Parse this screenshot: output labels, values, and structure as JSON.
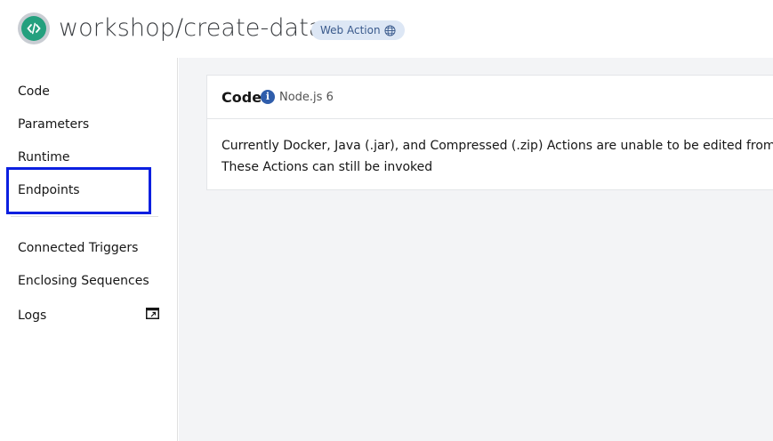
{
  "header": {
    "title": "workshop/create-data",
    "badge": "Web Action"
  },
  "sidebar": {
    "items": [
      {
        "label": "Code"
      },
      {
        "label": "Parameters"
      },
      {
        "label": "Runtime"
      },
      {
        "label": "Endpoints"
      },
      {
        "label": "Connected Triggers"
      },
      {
        "label": "Enclosing Sequences"
      },
      {
        "label": "Logs"
      }
    ]
  },
  "code_panel": {
    "title": "Code",
    "runtime": "Node.js 6",
    "message_line1": "Currently Docker, Java (.jar), and Compressed (.zip) Actions are unable to be edited from",
    "message_line2": "These Actions can still be invoked"
  },
  "colors": {
    "highlight": "#0b1fe0",
    "accent": "#24a07e",
    "badge_bg": "#dde7f5"
  }
}
